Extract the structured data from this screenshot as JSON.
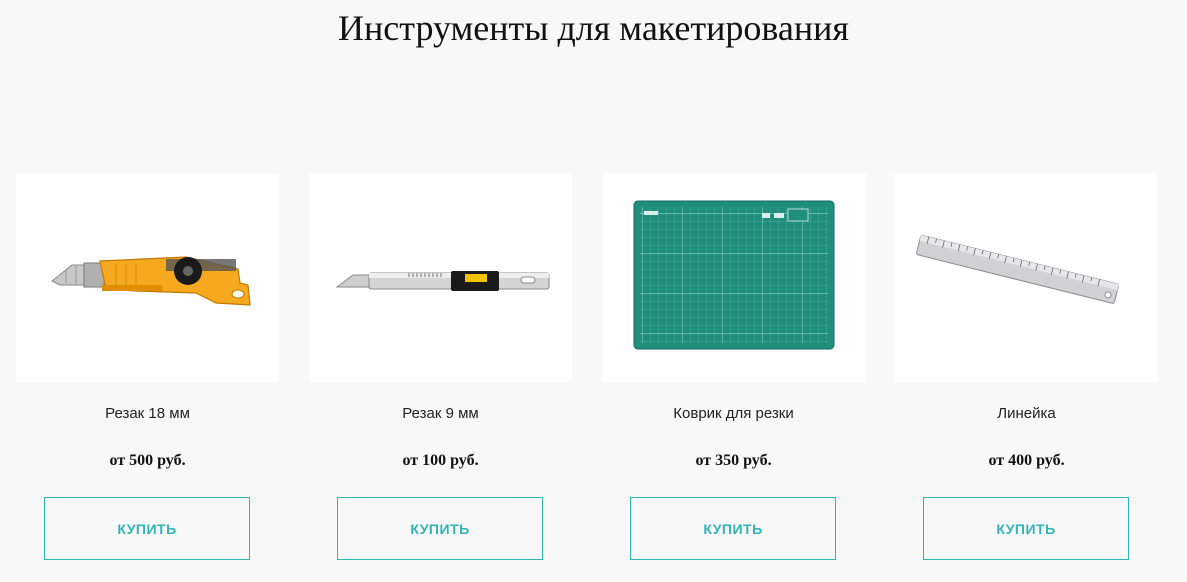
{
  "page": {
    "title": "Инструменты для макетирования"
  },
  "colors": {
    "accent": "#2fb5b5",
    "background": "#f8f8f8",
    "card_background": "#ffffff"
  },
  "products": [
    {
      "name": "Резак 18 мм",
      "price": "от 500 руб.",
      "button_label": "КУПИТЬ",
      "image_icon": "utility-knife-18mm"
    },
    {
      "name": "Резак 9 мм",
      "price": "от 100 руб.",
      "button_label": "КУПИТЬ",
      "image_icon": "utility-knife-9mm"
    },
    {
      "name": "Коврик для резки",
      "price": "от 350 руб.",
      "button_label": "КУПИТЬ",
      "image_icon": "cutting-mat"
    },
    {
      "name": "Линейка",
      "price": "от 400 руб.",
      "button_label": "КУПИТЬ",
      "image_icon": "steel-ruler"
    }
  ]
}
